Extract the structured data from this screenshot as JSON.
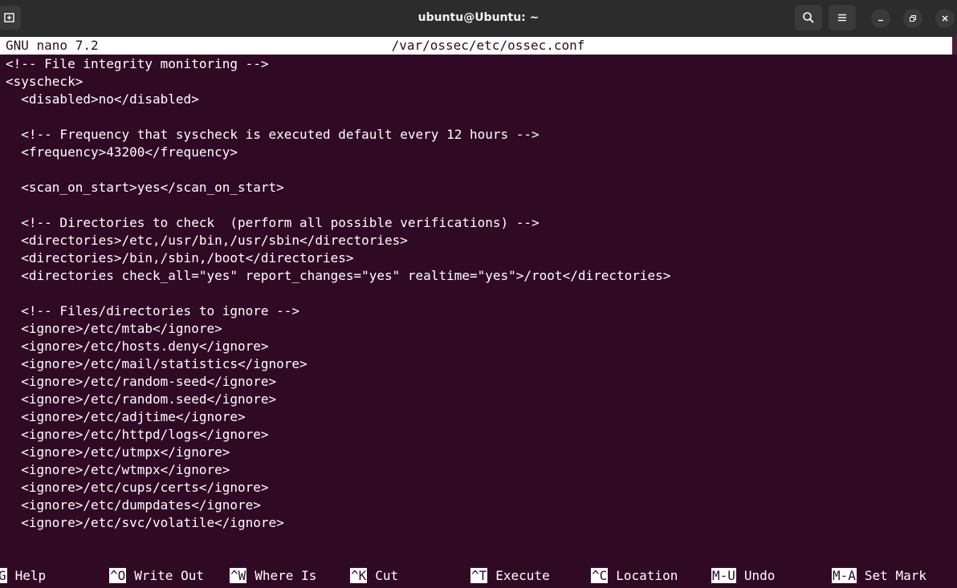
{
  "window": {
    "title": "ubuntu@Ubuntu: ~",
    "icons": [
      "new-tab-icon",
      "search-icon",
      "menu-icon",
      "minimize-icon",
      "maximize-icon",
      "close-icon"
    ]
  },
  "nano": {
    "version": "GNU nano 7.2",
    "filename": "/var/ossec/etc/ossec.conf"
  },
  "lines": [
    "<!-- File integrity monitoring -->",
    "<syscheck>",
    "  <disabled>no</disabled>",
    "",
    "  <!-- Frequency that syscheck is executed default every 12 hours -->",
    "  <frequency>43200</frequency>",
    "",
    "  <scan_on_start>yes</scan_on_start>",
    "",
    "  <!-- Directories to check  (perform all possible verifications) -->",
    "  <directories>/etc,/usr/bin,/usr/sbin</directories>",
    "  <directories>/bin,/sbin,/boot</directories>",
    "  <directories check_all=\"yes\" report_changes=\"yes\" realtime=\"yes\">/root</directories>",
    "",
    "  <!-- Files/directories to ignore -->",
    "  <ignore>/etc/mtab</ignore>",
    "  <ignore>/etc/hosts.deny</ignore>",
    "  <ignore>/etc/mail/statistics</ignore>",
    "  <ignore>/etc/random-seed</ignore>",
    "  <ignore>/etc/random.seed</ignore>",
    "  <ignore>/etc/adjtime</ignore>",
    "  <ignore>/etc/httpd/logs</ignore>",
    "  <ignore>/etc/utmpx</ignore>",
    "  <ignore>/etc/wtmpx</ignore>",
    "  <ignore>/etc/cups/certs</ignore>",
    "  <ignore>/etc/dumpdates</ignore>",
    "  <ignore>/etc/svc/volatile</ignore>"
  ],
  "shortcuts": [
    {
      "key": "G",
      "label": "Help"
    },
    {
      "key": "^O",
      "label": "Write Out"
    },
    {
      "key": "^W",
      "label": "Where Is"
    },
    {
      "key": "^K",
      "label": "Cut"
    },
    {
      "key": "^T",
      "label": "Execute"
    },
    {
      "key": "^C",
      "label": "Location"
    },
    {
      "key": "M-U",
      "label": "Undo"
    },
    {
      "key": "M-A",
      "label": "Set Mark"
    }
  ]
}
